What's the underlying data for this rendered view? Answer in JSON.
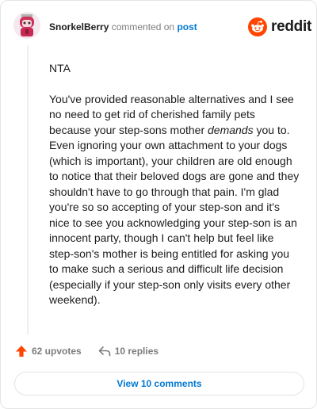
{
  "header": {
    "username": "SnorkelBerry",
    "action_text": "commented on",
    "post_link": "post"
  },
  "brand": {
    "wordmark": "reddit",
    "accent_color": "#FF4500"
  },
  "comment": {
    "verdict": "NTA",
    "text_before_emphasis": "You've provided reasonable alternatives and I see no need to get rid of cherished family pets because your step-sons mother ",
    "emphasis": "demands",
    "text_after_emphasis": " you to. Even ignoring your own attachment to your dogs (which is important), your children are old enough to notice that their beloved dogs are gone and they shouldn't have to go through that pain. I'm glad you're so so accepting of your step-son and it's nice to see you acknowledging your step-son is an innocent party, though I can't help but feel like step-son's mother is being entitled for asking you to make such a serious and difficult life decision (especially if your step-son only visits every other weekend)."
  },
  "actions": {
    "upvotes": "62 upvotes",
    "replies": "10 replies",
    "upvote_icon": "upvote-arrow-icon",
    "reply_icon": "reply-arrow-icon"
  },
  "footer": {
    "view_comments": "View 10 comments"
  },
  "colors": {
    "link_blue": "#0079D3",
    "upvote_orange": "#FF4500",
    "muted_gray": "#7C7C7C"
  }
}
